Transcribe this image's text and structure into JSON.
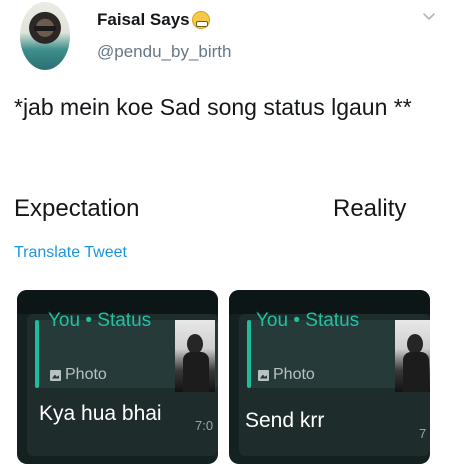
{
  "tweet": {
    "author_name": "Faisal Says",
    "emoji_icon": "grinning-face-icon",
    "author_handle": "@pendu_by_birth",
    "text": "*jab mein koe Sad song status lgaun **",
    "label_left": "Expectation",
    "label_right": "Reality",
    "translate_link": "Translate Tweet"
  },
  "cards": [
    {
      "status_title": "You • Status",
      "photo_label": "Photo",
      "message": "Kya hua bhai",
      "time": "7:0"
    },
    {
      "status_title": "You • Status",
      "photo_label": "Photo",
      "message": "Send krr",
      "time": "7"
    }
  ],
  "colors": {
    "link_blue": "#1b95e0",
    "whatsapp_green": "#1fc1a2",
    "chat_background": "#132121"
  }
}
